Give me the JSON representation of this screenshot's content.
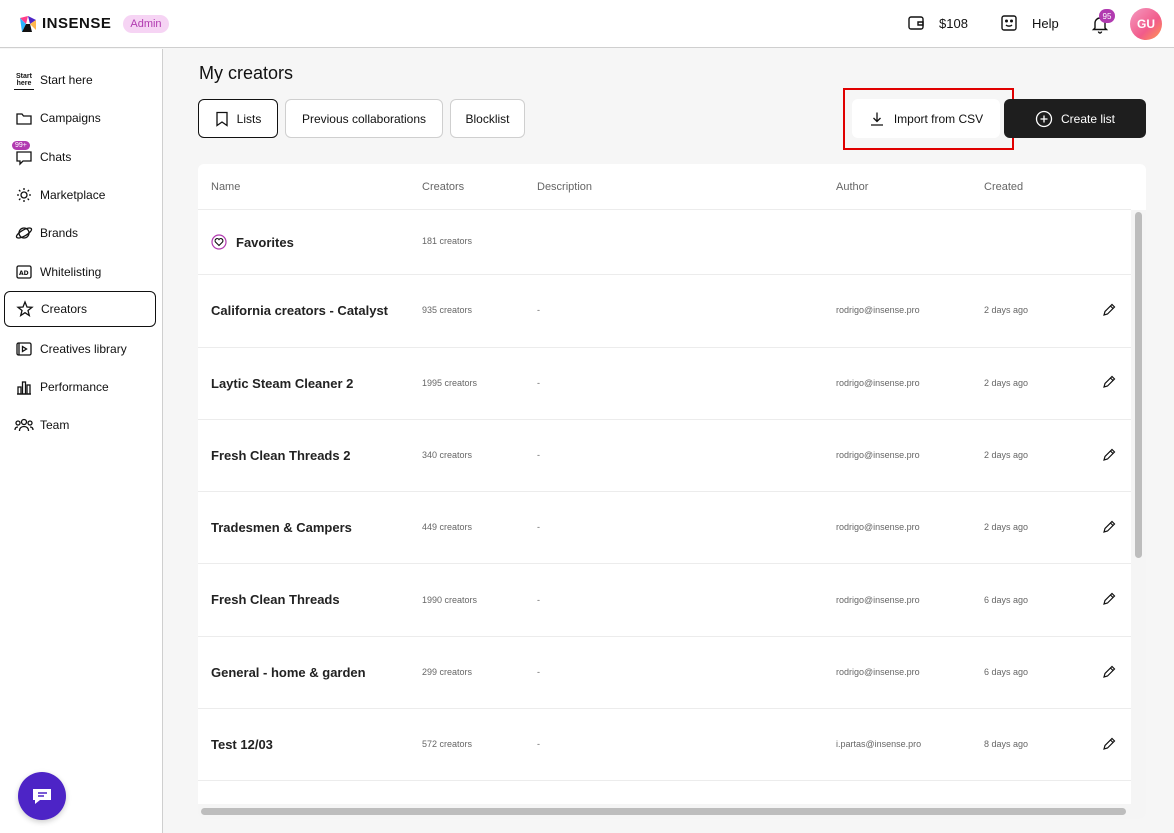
{
  "brand": {
    "name": "INSENSE",
    "badge": "Admin"
  },
  "topbar": {
    "balance": "$108",
    "help": "Help",
    "notifications": "95",
    "avatar": "GU"
  },
  "sidebar": {
    "start_icon_line1": "Start",
    "start_icon_line2": "here",
    "chats_badge": "99+",
    "items": [
      {
        "label": "Start here"
      },
      {
        "label": "Campaigns"
      },
      {
        "label": "Chats"
      },
      {
        "label": "Marketplace"
      },
      {
        "label": "Brands"
      },
      {
        "label": "Whitelisting"
      },
      {
        "label": "Creators"
      },
      {
        "label": "Creatives library"
      },
      {
        "label": "Performance"
      },
      {
        "label": "Team"
      }
    ]
  },
  "main": {
    "title": "My creators",
    "tabs": [
      "Lists",
      "Previous collaborations",
      "Blocklist"
    ],
    "import_label": "Import from CSV",
    "create_label": "Create list"
  },
  "table": {
    "columns": [
      "Name",
      "Creators",
      "Description",
      "Author",
      "Created"
    ],
    "rows": [
      {
        "name": "Favorites",
        "creators": "181 creators",
        "description": "",
        "author": "",
        "created": ""
      },
      {
        "name": "California creators - Catalyst",
        "creators": "935 creators",
        "description": "-",
        "author": "rodrigo@insense.pro",
        "created": "2 days ago"
      },
      {
        "name": "Laytic Steam Cleaner 2",
        "creators": "1995 creators",
        "description": "-",
        "author": "rodrigo@insense.pro",
        "created": "2 days ago"
      },
      {
        "name": "Fresh Clean Threads 2",
        "creators": "340 creators",
        "description": "-",
        "author": "rodrigo@insense.pro",
        "created": "2 days ago"
      },
      {
        "name": "Tradesmen & Campers",
        "creators": "449 creators",
        "description": "-",
        "author": "rodrigo@insense.pro",
        "created": "2 days ago"
      },
      {
        "name": "Fresh Clean Threads",
        "creators": "1990 creators",
        "description": "-",
        "author": "rodrigo@insense.pro",
        "created": "6 days ago"
      },
      {
        "name": "General - home & garden",
        "creators": "299 creators",
        "description": "-",
        "author": "rodrigo@insense.pro",
        "created": "6 days ago"
      },
      {
        "name": "Test 12/03",
        "creators": "572 creators",
        "description": "-",
        "author": "i.partas@insense.pro",
        "created": "8 days ago"
      }
    ]
  },
  "colors": {
    "accent": "#b13ab0",
    "highlight": "#e00000",
    "dark_button": "#1e1e1e",
    "chat_fab": "#4d24c6"
  }
}
